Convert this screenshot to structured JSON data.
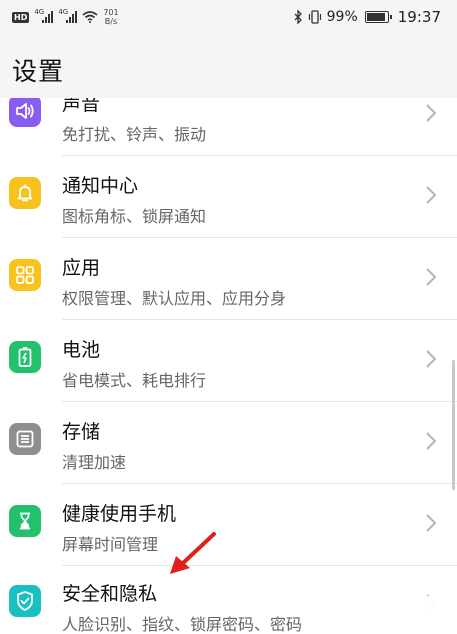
{
  "status_bar": {
    "hd": "HD",
    "net1": "4G",
    "net2": "4G",
    "speed_value": "701",
    "speed_unit": "B/s",
    "battery_pct": "99%",
    "time": "19:37",
    "icons": [
      "bluetooth-icon",
      "vibrate-icon",
      "wifi-icon",
      "battery-icon"
    ]
  },
  "header": {
    "title": "设置"
  },
  "settings": {
    "items": [
      {
        "label": "声音",
        "sub": "免打扰、铃声、振动",
        "icon": "speaker-icon",
        "color": "#8a5cf6"
      },
      {
        "label": "通知中心",
        "sub": "图标角标、锁屏通知",
        "icon": "bell-icon",
        "color": "#f7c21d"
      },
      {
        "label": "应用",
        "sub": "权限管理、默认应用、应用分身",
        "icon": "apps-grid-icon",
        "color": "#f7c21d"
      },
      {
        "label": "电池",
        "sub": "省电模式、耗电排行",
        "icon": "battery-charge-icon",
        "color": "#23c16b"
      },
      {
        "label": "存储",
        "sub": "清理加速",
        "icon": "storage-icon",
        "color": "#8e8e8e"
      },
      {
        "label": "健康使用手机",
        "sub": "屏幕时间管理",
        "icon": "hourglass-icon",
        "color": "#23c16b"
      },
      {
        "label": "安全和隐私",
        "sub": "人脸识别、指纹、锁屏密码、密码",
        "icon": "shield-check-icon",
        "color": "#18c0c0"
      }
    ]
  },
  "annotation": {
    "arrow_color": "#e0201c"
  }
}
